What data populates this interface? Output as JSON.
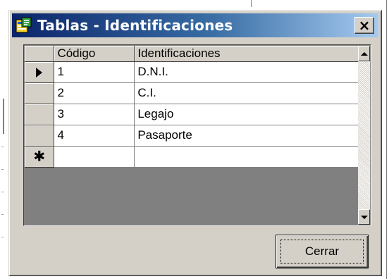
{
  "window": {
    "title": "Tablas - Identificaciones",
    "close_glyph": "×"
  },
  "grid": {
    "columns": [
      "Código",
      "Identificaciones"
    ],
    "rows": [
      {
        "codigo": "1",
        "identificacion": "D.N.I.",
        "indicator": "current-row-arrow"
      },
      {
        "codigo": "2",
        "identificacion": "C.I."
      },
      {
        "codigo": "3",
        "identificacion": "Legajo"
      },
      {
        "codigo": "4",
        "identificacion": "Pasaporte"
      },
      {
        "codigo": "",
        "identificacion": "",
        "indicator": "new-row-asterisk"
      }
    ],
    "new_row_glyph": "✱"
  },
  "buttons": {
    "cerrar": "Cerrar"
  },
  "colors": {
    "titlebar_start": "#0a246a",
    "titlebar_end": "#a6caf0",
    "face": "#d4d0c8"
  }
}
